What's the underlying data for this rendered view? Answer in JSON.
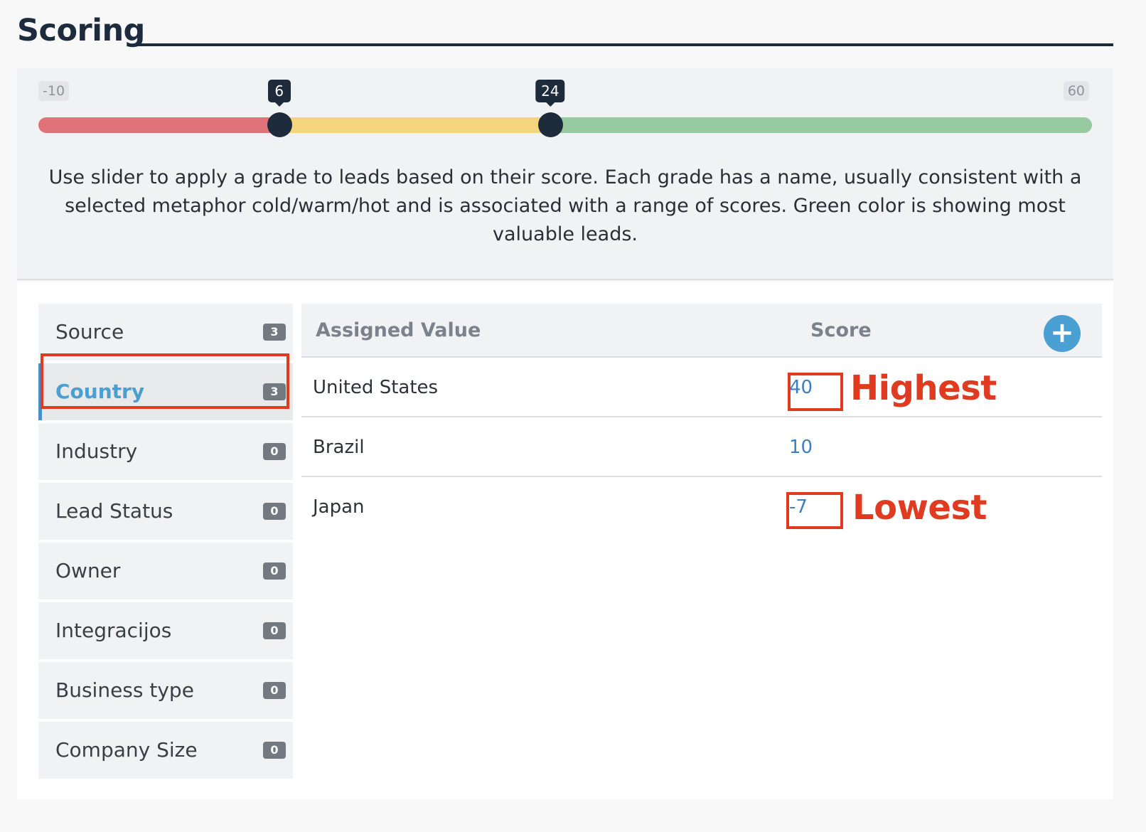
{
  "section": {
    "title": "Scoring"
  },
  "slider": {
    "min_label": "-10",
    "max_label": "60",
    "min": -10,
    "max": 60,
    "handles": [
      6,
      24
    ],
    "handle_labels": [
      "6",
      "24"
    ],
    "colors": {
      "low": "#e0737a",
      "mid": "#f5d47e",
      "high": "#97c9a0"
    },
    "description": "Use slider to apply a grade to leads based on their score. Each grade has a name, usually consistent with a selected metaphor cold/warm/hot and is associated with a range of scores. Green color is showing most valuable leads."
  },
  "categories": [
    {
      "label": "Source",
      "count": "3"
    },
    {
      "label": "Country",
      "count": "3",
      "active": true
    },
    {
      "label": "Industry",
      "count": "0"
    },
    {
      "label": "Lead Status",
      "count": "0"
    },
    {
      "label": "Owner",
      "count": "0"
    },
    {
      "label": "Integracijos",
      "count": "0"
    },
    {
      "label": "Business type",
      "count": "0"
    },
    {
      "label": "Company Size",
      "count": "0"
    }
  ],
  "table": {
    "headers": {
      "value": "Assigned Value",
      "score": "Score"
    },
    "add_icon": "plus-icon",
    "add_symbol": "+",
    "rows": [
      {
        "value": "United States",
        "score": "40"
      },
      {
        "value": "Brazil",
        "score": "10"
      },
      {
        "value": "Japan",
        "score": "-7"
      }
    ]
  },
  "annotations": {
    "highest": "Highest",
    "lowest": "Lowest",
    "color": "#e03a21"
  }
}
